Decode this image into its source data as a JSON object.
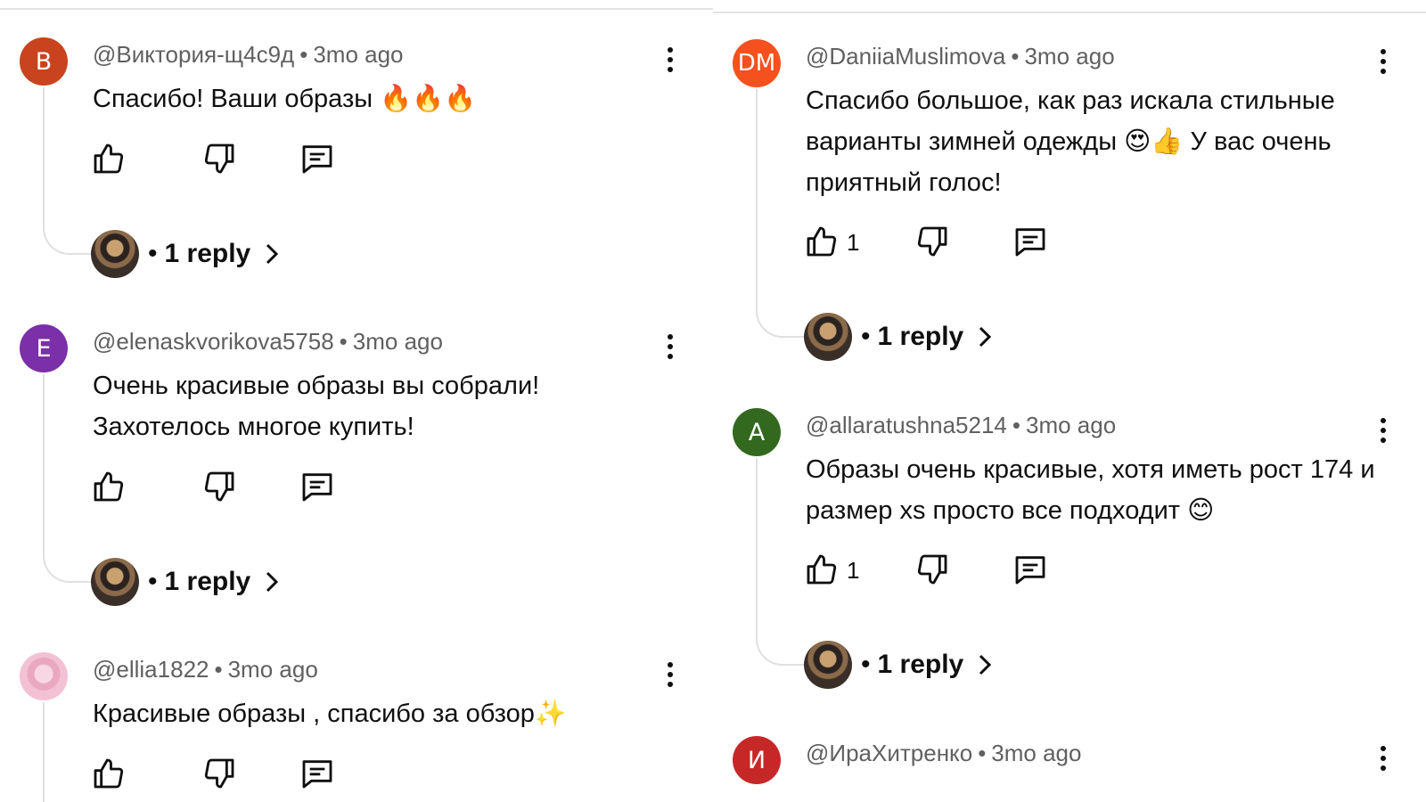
{
  "left": {
    "comments": [
      {
        "initial": "В",
        "avatar_color": "#c8431e",
        "author": "@Виктория-щ4с9д",
        "time": "3mo ago",
        "text": "Спасибо! Ваши образы 🔥🔥🔥",
        "likes": "",
        "replies": "1 reply"
      },
      {
        "initial": "E",
        "avatar_color": "#7b2fa8",
        "author": "@elenaskvorikova5758",
        "time": "3mo ago",
        "text": "Очень красивые образы вы собрали! Захотелось многое купить!",
        "likes": "",
        "replies": "1 reply"
      },
      {
        "initial": "",
        "avatar_color": "#f1c9d8",
        "author": "@ellia1822",
        "time": "3mo ago",
        "text": "Красивые образы , спасибо за обзор✨",
        "likes": "",
        "replies": ""
      }
    ]
  },
  "right": {
    "comments": [
      {
        "initial": "DM",
        "avatar_color": "#f4511e",
        "author": "@DaniiaMuslimova",
        "time": "3mo ago",
        "text": "Спасибо большое, как раз искала стильные варианты зимней одежды 😍👍 У вас очень приятный голос!",
        "likes": "1",
        "replies": "1 reply"
      },
      {
        "initial": "A",
        "avatar_color": "#33691e",
        "author": "@allaratushna5214",
        "time": "3mo ago",
        "text": "Образы очень красивые, хотя иметь рост 174 и размер xs просто все подходит 😊",
        "likes": "1",
        "replies": "1 reply"
      },
      {
        "initial": "И",
        "avatar_color": "#c62828",
        "author": "@ИраХитренко",
        "time": "3mo ago",
        "text": "",
        "likes": "",
        "replies": ""
      }
    ]
  },
  "separator": "•"
}
